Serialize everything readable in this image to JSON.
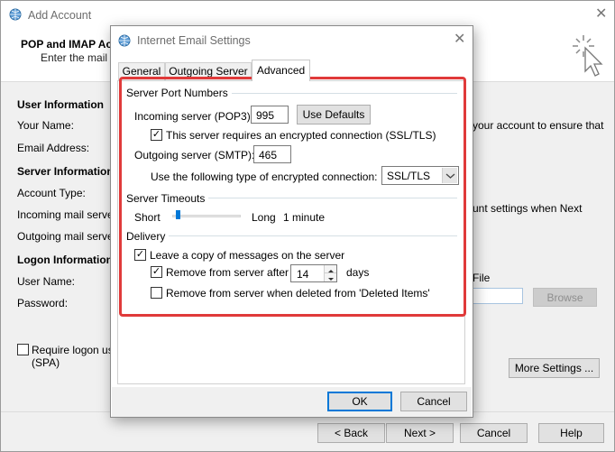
{
  "back_window": {
    "title": "Add Account",
    "heading": "POP and IMAP Account Settings",
    "subheading": "Enter the mail server settings for your account.",
    "user_info_header": "User Information",
    "your_name_label": "Your Name:",
    "email_label": "Email Address:",
    "server_info_header": "Server Information",
    "account_type_label": "Account Type:",
    "incoming_label": "Incoming mail server:",
    "outgoing_label": "Outgoing mail server (SMTP):",
    "logon_info_header": "Logon Information",
    "username_label": "User Name:",
    "password_label": "Password:",
    "spa_line1": "Require logon using Secure Password Authentication",
    "spa_line2": "(SPA)",
    "right_text1": "your account to ensure that",
    "right_text2": "unt settings when Next",
    "right_file": "File",
    "browse_label": "Browse",
    "more_settings_label": "More Settings ...",
    "back_label": "< Back",
    "next_label": "Next >",
    "cancel_label": "Cancel",
    "help_label": "Help"
  },
  "dialog": {
    "title": "Internet Email Settings",
    "tabs": [
      "General",
      "Outgoing Server",
      "Advanced"
    ],
    "active_tab": "Advanced",
    "server_ports": {
      "header": "Server Port Numbers",
      "incoming_label": "Incoming server (POP3):",
      "incoming_value": "995",
      "use_defaults_label": "Use Defaults",
      "ssl_label": "This server requires an encrypted connection (SSL/TLS)",
      "ssl_checked": true,
      "outgoing_label": "Outgoing server (SMTP):",
      "outgoing_value": "465",
      "encryption_label": "Use the following type of encrypted connection:",
      "encryption_value": "SSL/TLS"
    },
    "timeouts": {
      "header": "Server Timeouts",
      "short_label": "Short",
      "long_label": "Long",
      "value_label": "1 minute",
      "slider_fraction": 0.05
    },
    "delivery": {
      "header": "Delivery",
      "leave_copy_label": "Leave a copy of messages on the server",
      "leave_copy_checked": true,
      "remove_after_label": "Remove from server after",
      "remove_after_checked": true,
      "remove_after_days": "14",
      "days_label": "days",
      "remove_deleted_label": "Remove from server when deleted from 'Deleted Items'",
      "remove_deleted_checked": false
    },
    "ok_label": "OK",
    "cancel_label": "Cancel"
  },
  "colors": {
    "highlight_red": "#e03a3a",
    "accent_blue": "#0078d7"
  }
}
